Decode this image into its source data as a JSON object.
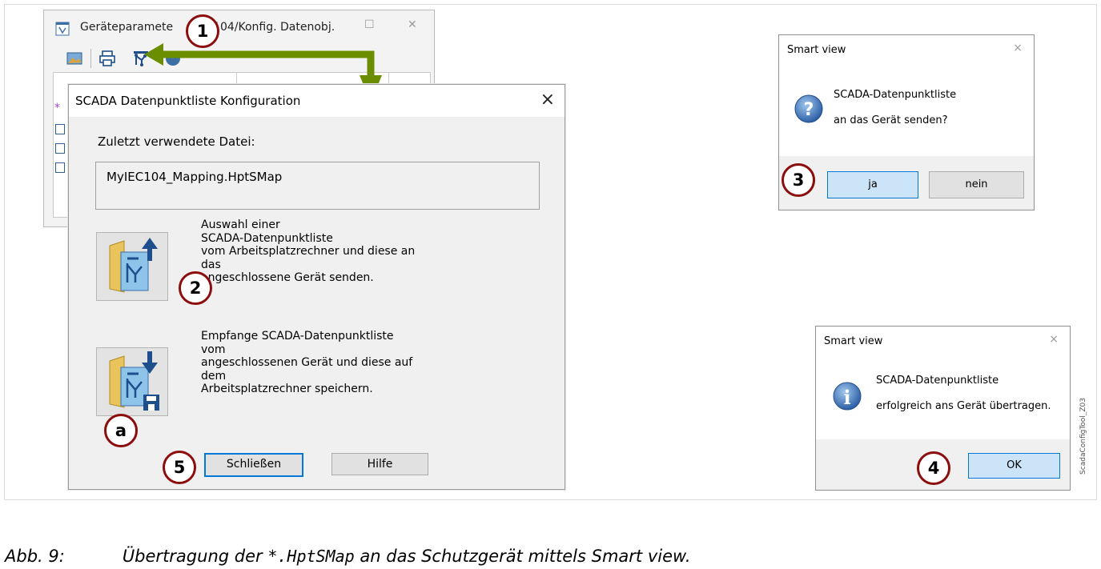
{
  "background_window": {
    "title": "Geräteparameter/IEC104/Konfig. Datenobj.",
    "title_visible": "Geräteparamete",
    "title_visible_2": "104/Konfig. Datenobj.",
    "toolbar": [
      "image-icon",
      "print-icon",
      "scada-config-icon",
      "globe-icon"
    ]
  },
  "dialog": {
    "title": "SCADA Datenpunktliste Konfiguration",
    "close": "×",
    "last_file_label": "Zuletzt verwendete Datei:",
    "last_file_value": "MyIEC104_Mapping.HptSMap",
    "send": {
      "line1": "Auswahl einer",
      "line2": "SCADA-Datenpunktliste",
      "line3": "vom Arbeitsplatzrechner und diese an",
      "line4": "das",
      "line5": "angeschlossene Gerät senden."
    },
    "receive": {
      "line1": "Empfange SCADA-Datenpunktliste",
      "line2": "vom",
      "line3": "angeschlossenen Gerät und diese auf",
      "line4": "dem",
      "line5": "Arbeitsplatzrechner speichern."
    },
    "close_button": "Schließen",
    "help_button": "Hilfe"
  },
  "smart_view_question": {
    "title": "Smart view",
    "close": "×",
    "message_line1": "SCADA-Datenpunktliste",
    "message_line2": "an das Gerät senden?",
    "yes_button": "ja",
    "no_button": "nein"
  },
  "smart_view_info": {
    "title": "Smart view",
    "close": "×",
    "message_line1": "SCADA-Datenpunktliste",
    "message_line2": "erfolgreich ans Gerät übertragen.",
    "ok_button": "OK"
  },
  "callouts": {
    "c1": "1",
    "c2": "2",
    "c3": "3",
    "c4": "4",
    "c5": "5",
    "ca": "a"
  },
  "caption": {
    "prefix": "Abb. 9:",
    "text1": "Übertragung der",
    "code": "*.HptSMap",
    "text2": "an das Schutzgerät mittels Smart view."
  },
  "side_label": "ScadaConfigTool_Z03",
  "colors": {
    "callout_border": "#8b0e0e",
    "arrow": "#6b8e00",
    "accent": "#0078d7"
  }
}
